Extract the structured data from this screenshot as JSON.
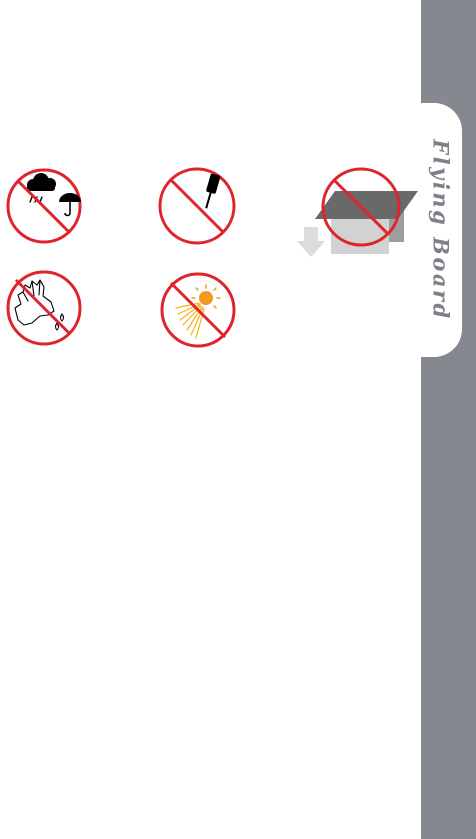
{
  "sidebar": {
    "title": "Flying Board"
  },
  "colors": {
    "prohibition_red": "#e0242b",
    "sidebar_gray": "#85898f",
    "sun_orange": "#f39a1e",
    "ray_yellow": "#f6b21a"
  },
  "warnings": [
    {
      "icon": "no-rain-icon"
    },
    {
      "icon": "no-sharp-tool-icon"
    },
    {
      "icon": "no-drop-icon"
    },
    {
      "icon": "no-wet-hands-icon"
    },
    {
      "icon": "no-sunlight-icon"
    }
  ]
}
